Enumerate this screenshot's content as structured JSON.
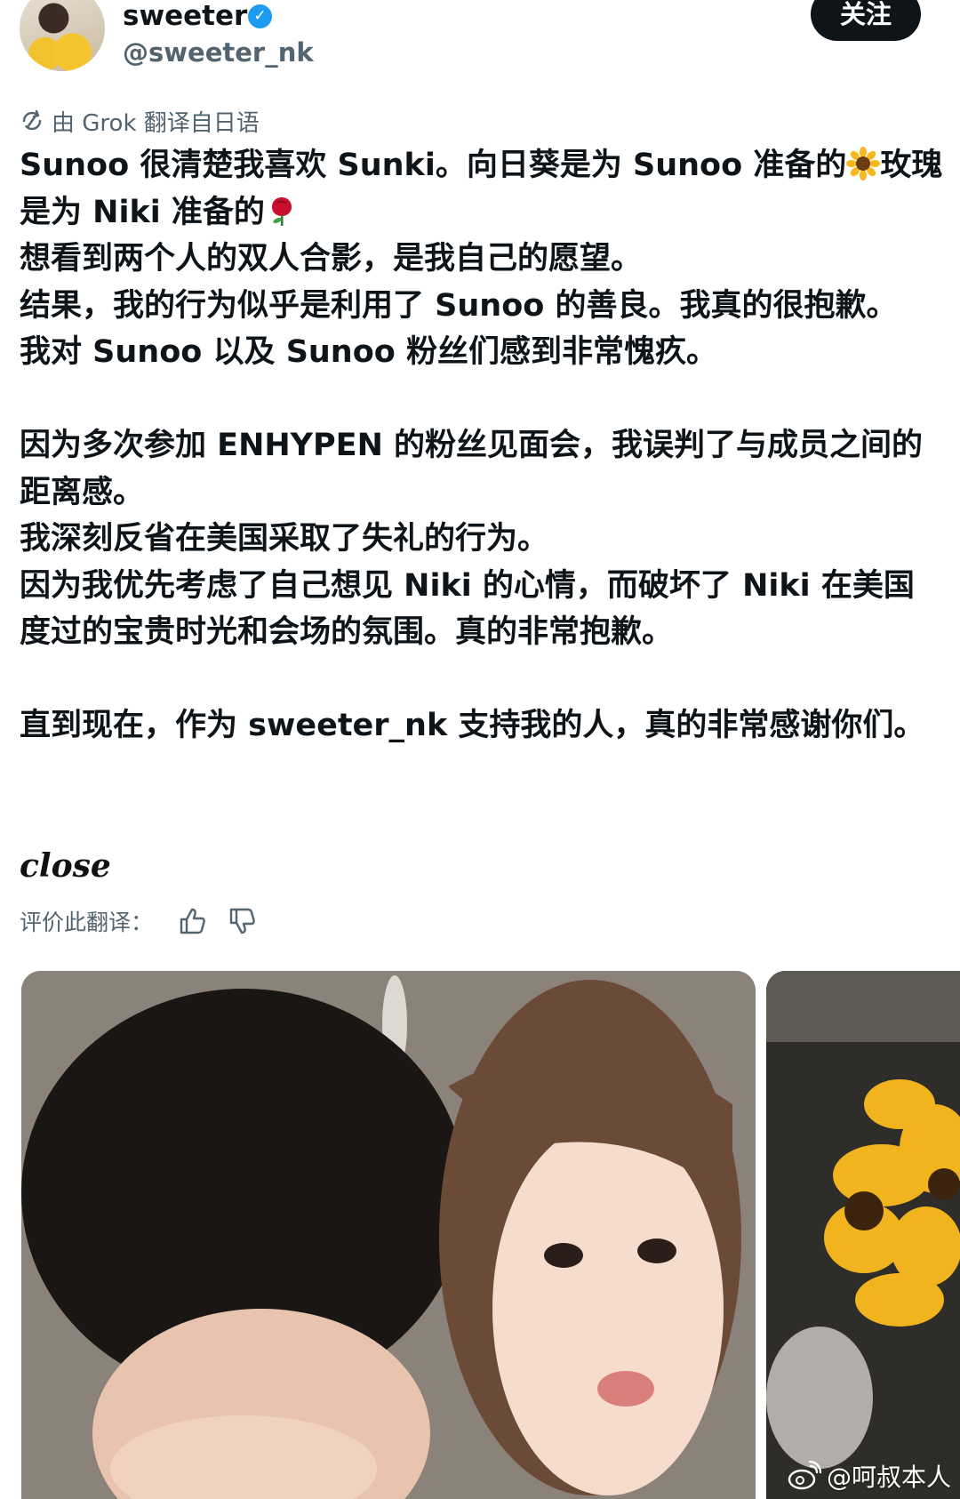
{
  "header": {
    "display_name": "sweeter",
    "handle": "@sweeter_nk",
    "follow_label": "关注"
  },
  "translation": {
    "note": "由 Grok 翻译自日语",
    "rate_label": "评价此翻译："
  },
  "tweet": {
    "line1": "Sunoo 很清楚我喜欢 Sunki。向日葵是为 Sunoo 准备的",
    "line1b": "玫瑰是为 Niki 准备的",
    "p2": "想看到两个人的双人合影，是我自己的愿望。",
    "p3": "结果，我的行为似乎是利用了 Sunoo 的善良。我真的很抱歉。",
    "p4": "我对 Sunoo 以及 Sunoo 粉丝们感到非常愧疚。",
    "p5": "因为多次参加 ENHYPEN 的粉丝见面会，我误判了与成员之间的距离感。",
    "p6": "我深刻反省在美国采取了失礼的行为。",
    "p7": "因为我优先考虑了自己想见 Niki 的心情，而破坏了 Niki 在美国度过的宝贵时光和会场的氛围。真的非常抱歉。",
    "p8": "直到现在，作为 sweeter_nk 支持我的人，真的非常感谢你们。",
    "closing": "close"
  },
  "icons": {
    "translate": "translate-icon",
    "verified": "verified-badge-icon",
    "sunflower": "sunflower-emoji",
    "rose": "rose-emoji",
    "thumbs_up": "thumbs-up-icon",
    "thumbs_down": "thumbs-down-icon",
    "weibo": "weibo-logo-icon"
  },
  "watermark": {
    "text": "@呵叔本人"
  },
  "colors": {
    "text_primary": "#0f1419",
    "text_secondary": "#536471",
    "verified_blue": "#1d9bf0",
    "follow_bg": "#0f1419"
  }
}
